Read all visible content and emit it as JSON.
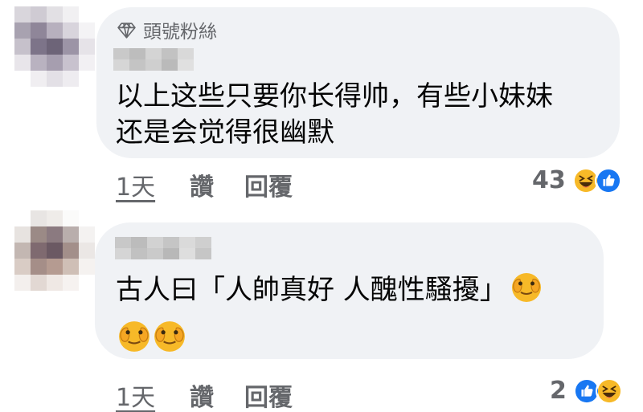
{
  "comments": [
    {
      "badge": "頭號粉絲",
      "lines": [
        "以上这些只要你长得帅，有些小妹妹",
        "还是会觉得很幽默"
      ],
      "actions": {
        "time": "1天",
        "like": "讚",
        "reply": "回覆"
      },
      "reaction_count": "43",
      "reaction_icons": [
        "haha-icon",
        "like-icon"
      ]
    },
    {
      "lines": [
        "古人曰「人帥真好 人醜性騷擾」"
      ],
      "trailing_emoji": [
        "see-no-evil-face-icon",
        "see-no-evil-face-icon"
      ],
      "actions": {
        "time": "1天",
        "like": "讚",
        "reply": "回覆"
      },
      "reaction_count": "2",
      "reaction_icons": [
        "like-icon",
        "haha-icon"
      ]
    }
  ],
  "colors": {
    "bubble": "#f0f2f5",
    "secondary_text": "#65676b",
    "like_blue": "#1877f2",
    "haha_yellow": "#f7b928"
  }
}
